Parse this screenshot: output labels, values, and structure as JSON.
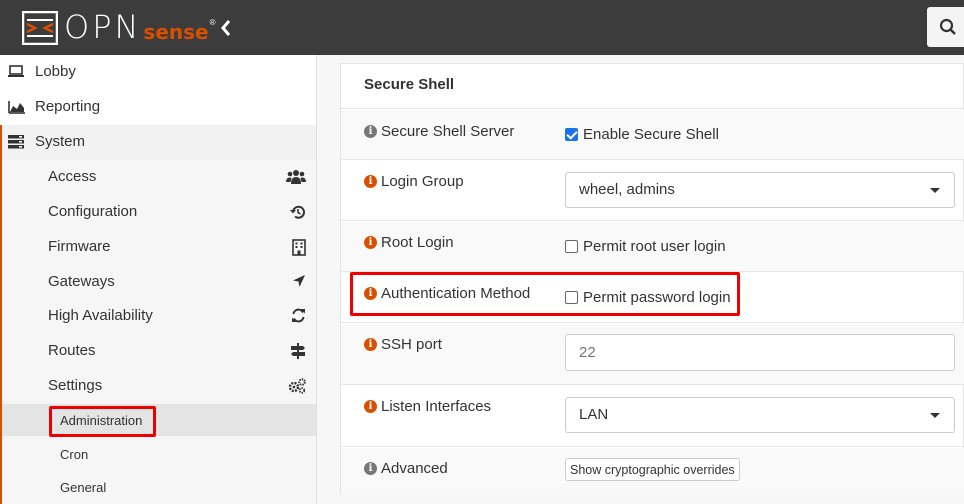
{
  "brand": {
    "name_main": "OPN",
    "name_accent": "sense",
    "reg_mark": "®",
    "accent_color": "#d94f00"
  },
  "sidebar": {
    "top_items": [
      {
        "label": "Lobby",
        "icon": "laptop-icon"
      },
      {
        "label": "Reporting",
        "icon": "area-chart-icon"
      },
      {
        "label": "System",
        "icon": "server-icon"
      }
    ],
    "system_items": [
      {
        "label": "Access",
        "icon": "users-icon"
      },
      {
        "label": "Configuration",
        "icon": "history-icon"
      },
      {
        "label": "Firmware",
        "icon": "building-icon"
      },
      {
        "label": "Gateways",
        "icon": "location-arrow-icon"
      },
      {
        "label": "High Availability",
        "icon": "refresh-icon"
      },
      {
        "label": "Routes",
        "icon": "map-signs-icon"
      },
      {
        "label": "Settings",
        "icon": "cogs-icon"
      }
    ],
    "settings_items": [
      {
        "label": "Administration",
        "active": true
      },
      {
        "label": "Cron"
      },
      {
        "label": "General"
      }
    ]
  },
  "panel": {
    "title": "Secure Shell",
    "rows": [
      {
        "label": "Secure Shell Server",
        "info_color": "grey",
        "control": "checkbox",
        "checked": true,
        "text": "Enable Secure Shell"
      },
      {
        "label": "Login Group",
        "info_color": "orange",
        "control": "select",
        "value": "wheel, admins"
      },
      {
        "label": "Root Login",
        "info_color": "orange",
        "control": "checkbox",
        "checked": false,
        "text": "Permit root user login"
      },
      {
        "label": "Authentication Method",
        "info_color": "orange",
        "control": "checkbox",
        "checked": false,
        "text": "Permit password login"
      },
      {
        "label": "SSH port",
        "info_color": "orange",
        "control": "text",
        "placeholder": "22"
      },
      {
        "label": "Listen Interfaces",
        "info_color": "orange",
        "control": "select",
        "value": "LAN"
      },
      {
        "label": "Advanced",
        "info_color": "grey",
        "control": "button",
        "text": "Show cryptographic overrides"
      }
    ]
  }
}
